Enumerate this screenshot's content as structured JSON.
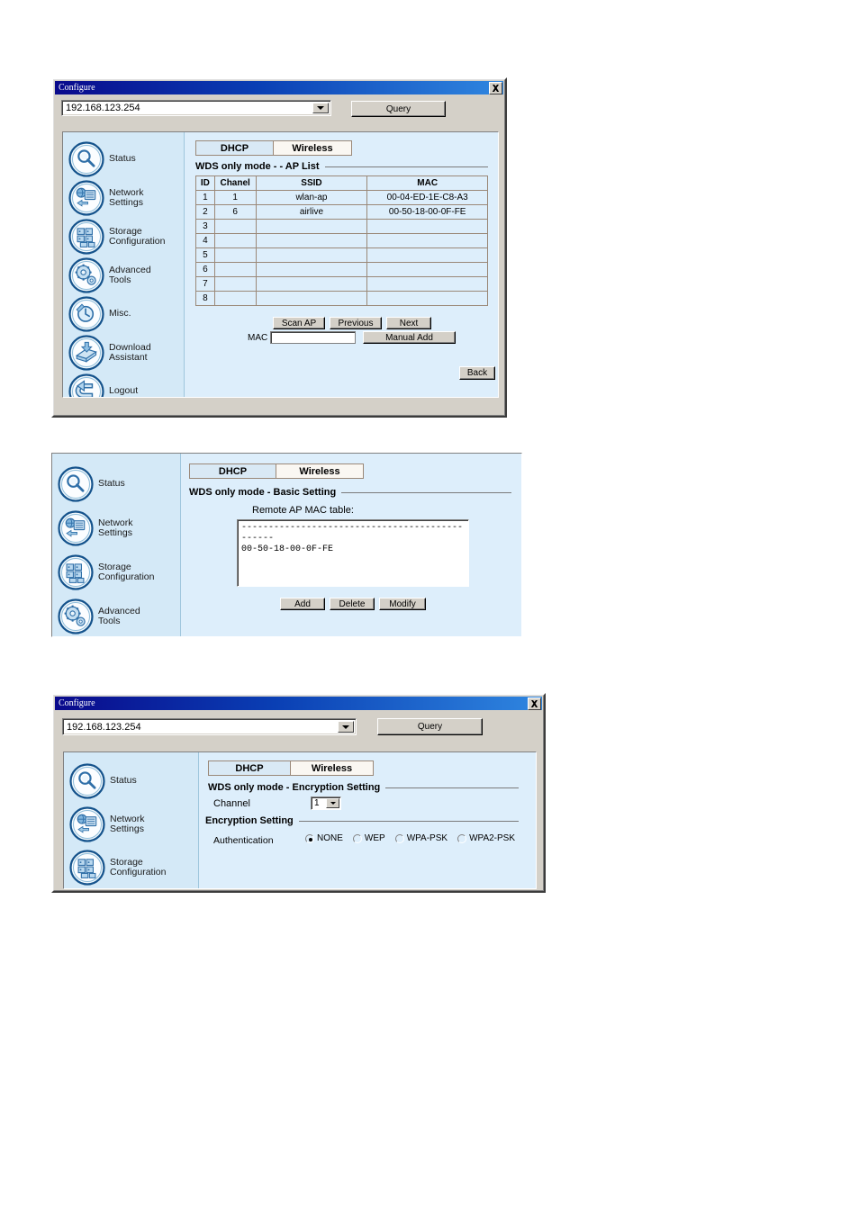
{
  "window1": {
    "title": "Configure",
    "close_icon": "close-icon",
    "address": {
      "value": "192.168.123.254"
    },
    "query_label": "Query",
    "tabs": [
      {
        "label": "DHCP",
        "active": false
      },
      {
        "label": "Wireless",
        "active": true
      }
    ],
    "sidebar": [
      {
        "label": "Status",
        "icon": "magnifier-icon"
      },
      {
        "label": "Network\nSettings",
        "icon": "network-icon"
      },
      {
        "label": "Storage\nConfiguration",
        "icon": "storage-grid-icon"
      },
      {
        "label": "Advanced\nTools",
        "icon": "gears-icon"
      },
      {
        "label": "Misc.",
        "icon": "clock-icon"
      },
      {
        "label": "Download\nAssistant",
        "icon": "download-tray-icon"
      },
      {
        "label": "Logout",
        "icon": "logout-arrow-icon"
      }
    ],
    "section_title": "WDS only mode - - AP List",
    "table": {
      "headers": [
        "ID",
        "Chanel",
        "SSID",
        "MAC"
      ],
      "rows": [
        {
          "id": "1",
          "channel": "1",
          "ssid": "wlan-ap",
          "mac": "00-04-ED-1E-C8-A3"
        },
        {
          "id": "2",
          "channel": "6",
          "ssid": "airlive",
          "mac": "00-50-18-00-0F-FE"
        },
        {
          "id": "3",
          "channel": "",
          "ssid": "",
          "mac": ""
        },
        {
          "id": "4",
          "channel": "",
          "ssid": "",
          "mac": ""
        },
        {
          "id": "5",
          "channel": "",
          "ssid": "",
          "mac": ""
        },
        {
          "id": "6",
          "channel": "",
          "ssid": "",
          "mac": ""
        },
        {
          "id": "7",
          "channel": "",
          "ssid": "",
          "mac": ""
        },
        {
          "id": "8",
          "channel": "",
          "ssid": "",
          "mac": ""
        }
      ]
    },
    "buttons": {
      "scan_ap": "Scan AP",
      "previous": "Previous",
      "next": "Next",
      "manual_add": "Manual Add",
      "back": "Back"
    },
    "mac_label": "MAC",
    "mac_input_value": ""
  },
  "panel2": {
    "tabs": [
      {
        "label": "DHCP",
        "active": false
      },
      {
        "label": "Wireless",
        "active": true
      }
    ],
    "sidebar": [
      {
        "label": "Status",
        "icon": "magnifier-icon"
      },
      {
        "label": "Network\nSettings",
        "icon": "network-icon"
      },
      {
        "label": "Storage\nConfiguration",
        "icon": "storage-grid-icon"
      },
      {
        "label": "Advanced\nTools",
        "icon": "gears-icon"
      }
    ],
    "section_title": "WDS only mode - Basic Setting",
    "table_caption": "Remote AP MAC table:",
    "mac_table_divider": "-----------------------------------------------",
    "mac_table_entries": [
      "00-50-18-00-0F-FE"
    ],
    "buttons": {
      "add": "Add",
      "delete": "Delete",
      "modify": "Modify"
    }
  },
  "window3": {
    "title": "Configure",
    "close_icon": "close-icon",
    "address": {
      "value": "192.168.123.254"
    },
    "query_label": "Query",
    "tabs": [
      {
        "label": "DHCP",
        "active": false
      },
      {
        "label": "Wireless",
        "active": true
      }
    ],
    "sidebar": [
      {
        "label": "Status",
        "icon": "magnifier-icon"
      },
      {
        "label": "Network\nSettings",
        "icon": "network-icon"
      },
      {
        "label": "Storage\nConfiguration",
        "icon": "storage-grid-icon"
      }
    ],
    "section_title": "WDS only mode - Encryption Setting",
    "channel_label": "Channel",
    "channel_value": "1",
    "encryption_title": "Encryption Setting",
    "auth_label": "Authentication",
    "auth_options": [
      {
        "label": "NONE",
        "selected": true
      },
      {
        "label": "WEP",
        "selected": false
      },
      {
        "label": "WPA-PSK",
        "selected": false
      },
      {
        "label": "WPA2-PSK",
        "selected": false
      }
    ]
  },
  "colors": {
    "titlebar_start": "#0a0a8c",
    "titlebar_end": "#2f86e0",
    "dialog_face": "#d4d0c8",
    "content_blue": "#ddeefb",
    "sidebar_blue": "#d4e9f7",
    "icon_blue": "#2f6fa8"
  }
}
